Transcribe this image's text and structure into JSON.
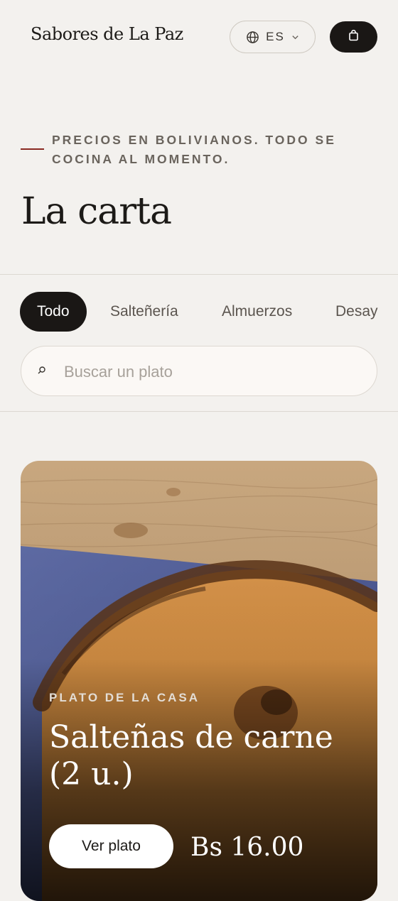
{
  "header": {
    "brand": "Sabores de La Paz",
    "language": "ES"
  },
  "intro": {
    "eyebrow": "PRECIOS EN BOLIVIANOS. TODO SE COCINA AL MOMENTO.",
    "title": "La carta"
  },
  "tabs": [
    {
      "label": "Todo"
    },
    {
      "label": "Salteñería"
    },
    {
      "label": "Almuerzos"
    },
    {
      "label": "Desay"
    }
  ],
  "search": {
    "placeholder": "Buscar un plato",
    "value": ""
  },
  "featured": {
    "label": "PLATO DE LA CASA",
    "title": "Salteñas de carne (2 u.)",
    "button_label": "Ver plato",
    "price": "Bs 16.00"
  },
  "colors": {
    "background": "#f3f1ee",
    "accent_dark": "#1a1715",
    "accent_red": "#8a2a22"
  },
  "icons": {
    "language": "globe-icon",
    "language_chevron": "chevron-down-icon",
    "cart": "shopping-bag-icon",
    "search": "search-icon"
  }
}
